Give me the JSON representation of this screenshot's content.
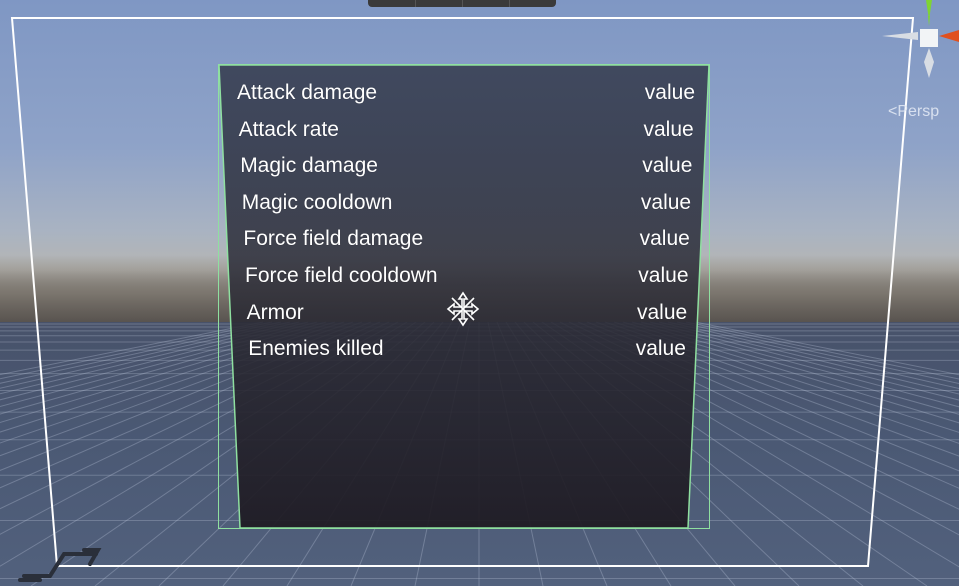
{
  "scene_view": {
    "projection_label": "<Persp",
    "gizmo_axes": [
      "y-green",
      "x-red",
      "z-blue-hidden"
    ],
    "colors": {
      "canvas_border": "#ffffff",
      "panel_border": "#8fe0a0",
      "gizmo_y": "#7fd433",
      "gizmo_x": "#e0501e"
    }
  },
  "stats_panel": {
    "rows": [
      {
        "label": "Attack damage",
        "value": "value"
      },
      {
        "label": "Attack rate",
        "value": "value"
      },
      {
        "label": "Magic damage",
        "value": "value"
      },
      {
        "label": "Magic cooldown",
        "value": "value"
      },
      {
        "label": "Force field damage",
        "value": "value"
      },
      {
        "label": "Force field cooldown",
        "value": "value"
      },
      {
        "label": "Armor",
        "value": "value"
      },
      {
        "label": "Enemies killed",
        "value": "value"
      }
    ]
  },
  "icons": {
    "move_tool": "move-tool-icon",
    "orientation_gizmo": "scene-gizmo-icon",
    "corner": "2d-toggle-icon"
  }
}
